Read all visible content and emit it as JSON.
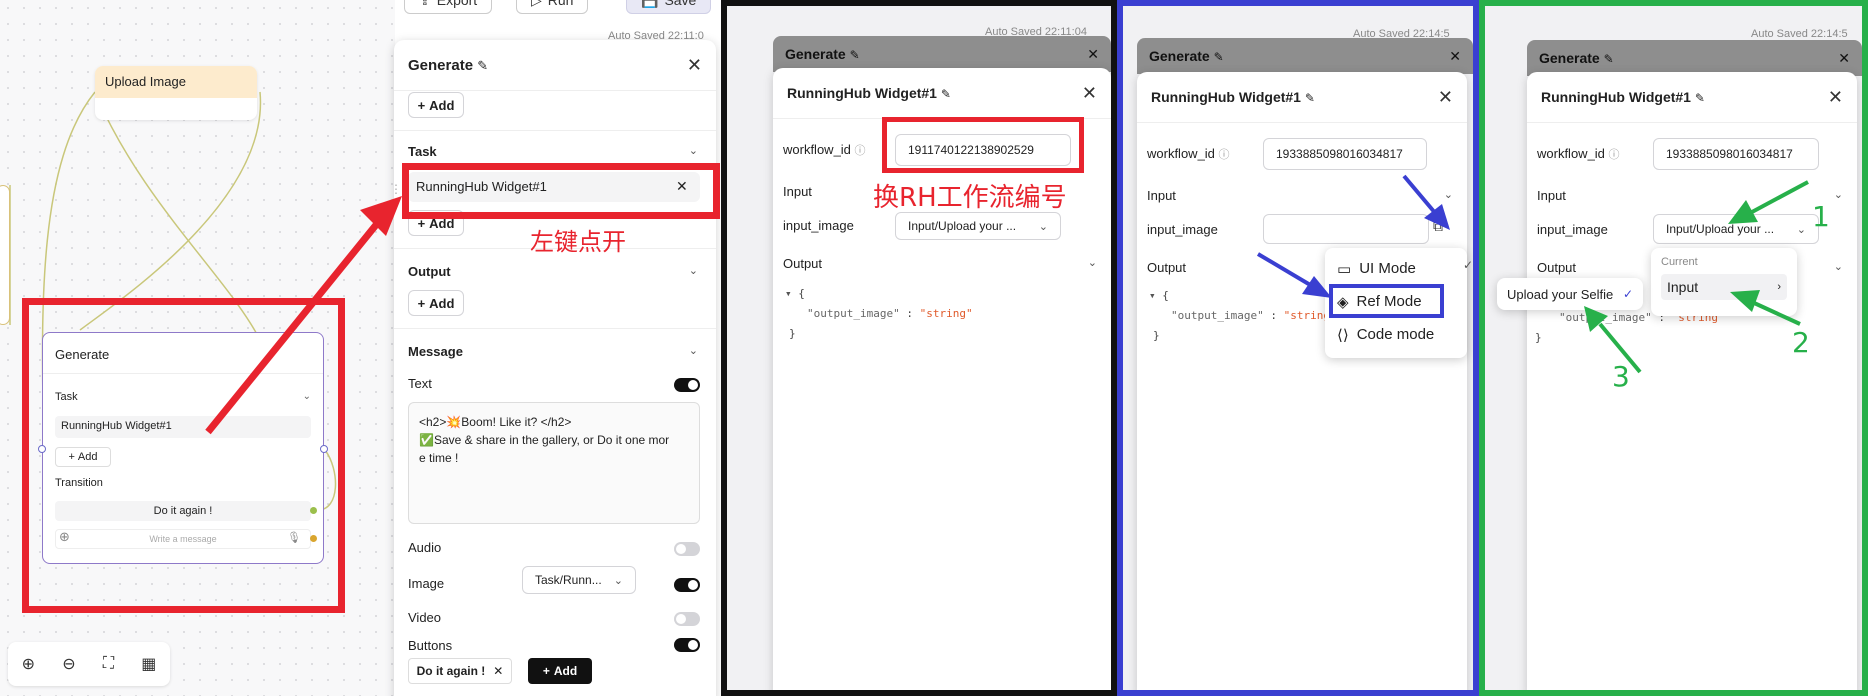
{
  "toolbar": {
    "export": "Export",
    "run": "Run",
    "save": "Save"
  },
  "canvas": {
    "upload_node": "Upload Image",
    "generate_node": {
      "title": "Generate",
      "task_label": "Task",
      "task_value": "RunningHub Widget#1",
      "add": "Add",
      "transition_label": "Transition",
      "transition_value": "Do it again !",
      "message_placeholder": "Write a message"
    }
  },
  "generate_panel": {
    "title": "Generate",
    "add": "Add",
    "task_label": "Task",
    "task_value": "RunningHub Widget#1",
    "output_label": "Output",
    "message_label": "Message",
    "text_label": "Text",
    "text_line1": "<h2>💥Boom! Like it? </h2>",
    "text_line2": "✅Save & share in the gallery, or Do it one mor",
    "text_line3": "e time !",
    "audio_label": "Audio",
    "image_label": "Image",
    "image_value": "Task/Runn...",
    "video_label": "Video",
    "buttons_label": "Buttons",
    "button_chip": "Do it again !",
    "add_button": "Add"
  },
  "panel2": {
    "bg_title": "Generate",
    "title": "RunningHub Widget#1",
    "autosave": "Auto Saved 22:11:04",
    "workflow_label": "workflow_id",
    "workflow_value": "1911740122138902529",
    "input_label": "Input",
    "input_image_label": "input_image",
    "input_image_value": "Input/Upload your ...",
    "output_label": "Output",
    "code_brace_open": "{",
    "code_key": "\"output_image\"",
    "code_colon": " : ",
    "code_val": "\"string\"",
    "code_brace_close": "}"
  },
  "panel3": {
    "bg_title": "Generate",
    "title": "RunningHub Widget#1",
    "autosave": "Auto Saved 22:14:5",
    "workflow_label": "workflow_id",
    "workflow_value": "1933885098016034817",
    "input_label": "Input",
    "input_image_label": "input_image",
    "output_label": "Output",
    "code_brace_open": "{",
    "code_key": "\"output_image\"",
    "code_colon": " : ",
    "code_val": "\"string",
    "code_brace_close": "}",
    "menu": [
      "UI Mode",
      "Ref Mode",
      "Code mode"
    ]
  },
  "panel4": {
    "bg_title": "Generate",
    "title": "RunningHub Widget#1",
    "autosave": "Auto Saved 22:14:5",
    "workflow_label": "workflow_id",
    "workflow_value": "1933885098016034817",
    "input_label": "Input",
    "input_image_label": "input_image",
    "input_image_value": "Input/Upload your ...",
    "output_label": "Output",
    "code_key": "\"output_image\"",
    "code_colon": " : ",
    "code_val": "\"string\"",
    "code_brace_close": "}",
    "menu_current": "Current",
    "menu_input": "Input",
    "submenu_item": "Upload your Selfie"
  },
  "annotations": {
    "left_click_open": "左键点开",
    "change_rh_id": "换RH工作流编号",
    "n1": "1",
    "n2": "2",
    "n3": "3"
  },
  "colors": {
    "red": "#e8242e",
    "blue": "#3a3fd1",
    "green": "#27b04a",
    "orange": "#e05a2b"
  }
}
